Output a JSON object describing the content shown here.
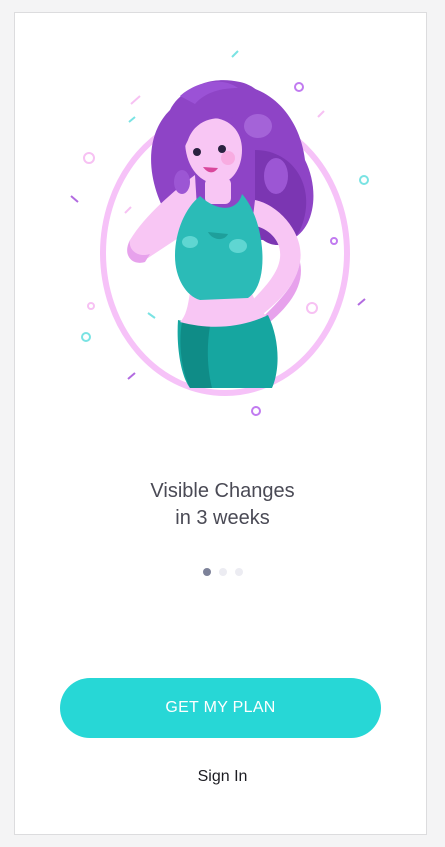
{
  "onboarding": {
    "headline_line1": "Visible Changes",
    "headline_line2": "in 3 weeks",
    "page_indicator": {
      "current": 1,
      "total": 3
    }
  },
  "actions": {
    "primary_label": "GET MY PLAN",
    "secondary_label": "Sign In"
  },
  "colors": {
    "accent": "#27d7d6",
    "frame": "#f6c2f8",
    "hair": "#8e44c6",
    "outfit": "#16a6a0",
    "text": "#4a4a55"
  },
  "icons": [
    "woman-illustration",
    "decorative-confetti"
  ]
}
